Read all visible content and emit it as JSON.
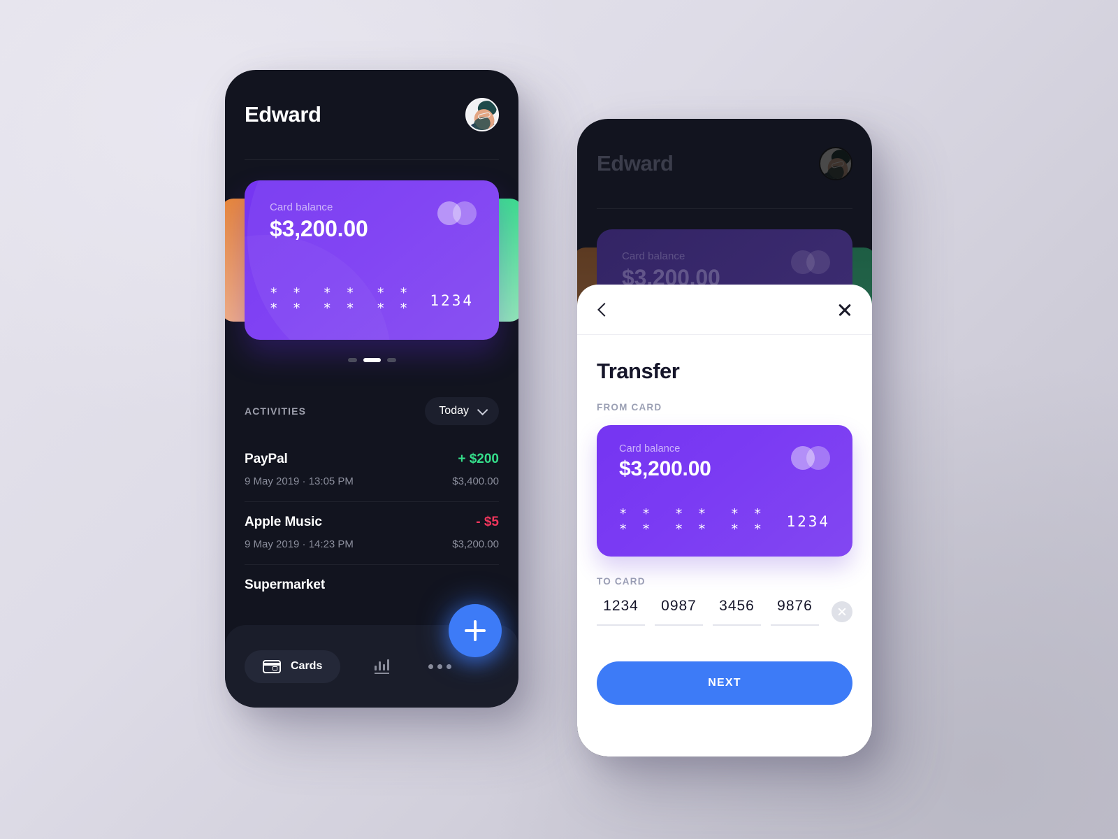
{
  "left_phone": {
    "header": {
      "user_name": "Edward",
      "avatar": "user-avatar"
    },
    "card": {
      "label": "Card balance",
      "balance": "$3,200.00",
      "number_group_1": "* * * *",
      "number_group_2": "* * * *",
      "number_group_3": "* * * *",
      "number_last4": "1234",
      "brand_icon": "mastercard-icon",
      "color": "#7b3bf3",
      "side_card_left_color": "#e8883b",
      "side_card_right_color": "#3ddd8e"
    },
    "pagination": {
      "total": 3,
      "active_index": 1
    },
    "activities": {
      "title": "ACTIVITIES",
      "filter_label": "Today",
      "items": [
        {
          "name": "PayPal",
          "amount": "+ $200",
          "direction": "positive",
          "date": "9 May 2019 · 13:05 PM",
          "balance": "$3,400.00"
        },
        {
          "name": "Apple Music",
          "amount": "- $5",
          "direction": "negative",
          "date": "9 May 2019 · 14:23 PM",
          "balance": "$3,200.00"
        },
        {
          "name": "Supermarket",
          "amount": "",
          "direction": "negative",
          "date": "",
          "balance": ""
        }
      ]
    },
    "nav": {
      "cards_label": "Cards",
      "cards_icon": "credit-card-icon",
      "stats_icon": "bar-chart-icon",
      "more_icon": "ellipsis-icon",
      "fab_icon": "plus-icon",
      "fab_color": "#3d7bf7"
    }
  },
  "right_phone": {
    "background": {
      "header": {
        "user_name": "Edward",
        "avatar": "user-avatar"
      },
      "card": {
        "label": "Card balance",
        "balance": "$3,200.00"
      }
    },
    "sheet": {
      "back_icon": "chevron-left-icon",
      "close_icon": "close-icon",
      "title": "Transfer",
      "from_label": "FROM CARD",
      "from_card": {
        "label": "Card balance",
        "balance": "$3,200.00",
        "number_group_1": "* * * *",
        "number_group_2": "* * * *",
        "number_group_3": "* * * *",
        "number_last4": "1234",
        "brand_icon": "mastercard-icon"
      },
      "to_label": "TO CARD",
      "to_card_digits": [
        "1234",
        "0987",
        "3456",
        "9876"
      ],
      "clear_icon": "clear-circle-icon",
      "next_label": "NEXT",
      "next_color": "#3d7bf7"
    }
  }
}
